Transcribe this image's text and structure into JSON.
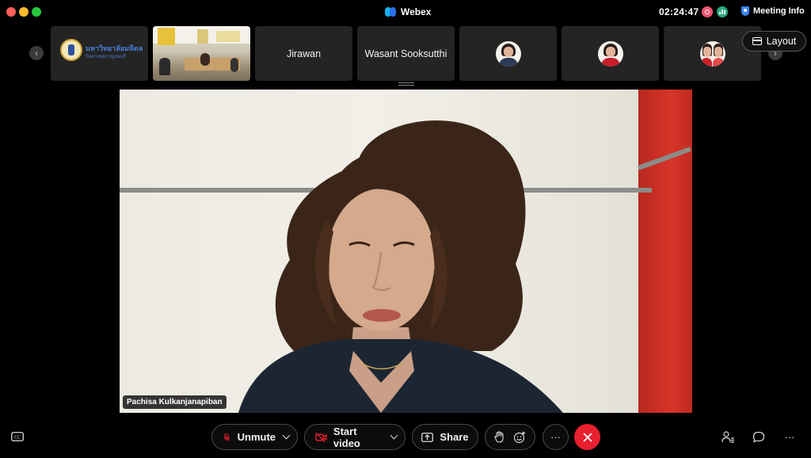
{
  "window": {
    "app_title": "Webex",
    "clock": "02:24:47",
    "meeting_info_label": "Meeting Info",
    "layout_label": "Layout"
  },
  "filmstrip": {
    "tiles": [
      {
        "kind": "logo",
        "logo_text_line1": "มหาวิทยาลัยมหิดล",
        "logo_text_line2": "วิทยาเขตกาญจนบุรี"
      },
      {
        "kind": "room-video"
      },
      {
        "kind": "name",
        "name": "Jirawan"
      },
      {
        "kind": "name",
        "name": "Wasant Sooksutthi"
      },
      {
        "kind": "avatar"
      },
      {
        "kind": "avatar"
      },
      {
        "kind": "avatar"
      }
    ]
  },
  "main_video": {
    "speaker_name": "Pachisa Kulkanjanapiban"
  },
  "controls": {
    "unmute_label": "Unmute",
    "start_video_label": "Start video",
    "share_label": "Share",
    "more_label": "···"
  },
  "icons": {
    "closed_captions": "CC"
  },
  "colors": {
    "end_call": "#e8202f",
    "recording": "#f0536e",
    "stats": "#2aa87e",
    "webex_blue": "#2f6ee8"
  }
}
